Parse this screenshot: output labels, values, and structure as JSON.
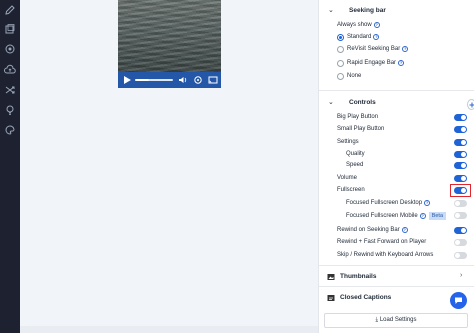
{
  "sidebar": {
    "icons": [
      {
        "name": "edit-icon"
      },
      {
        "name": "layers-icon"
      },
      {
        "name": "settings-cog-icon"
      },
      {
        "name": "cloud-upload-icon"
      },
      {
        "name": "shuffle-icon"
      },
      {
        "name": "bulb-icon"
      },
      {
        "name": "palette-icon"
      }
    ]
  },
  "player": {
    "progress_fraction": 0.35,
    "controls": [
      "play-icon",
      "volume-icon",
      "gear-icon",
      "cast-icon"
    ]
  },
  "seeking_bar": {
    "title": "Seeking bar",
    "always_show_label": "Always show",
    "options": [
      {
        "label": "Standard",
        "selected": true
      },
      {
        "label": "ReVisit Seeking Bar",
        "selected": false
      },
      {
        "label": "Rapid Engage Bar",
        "selected": false
      },
      {
        "label": "None",
        "selected": false
      }
    ]
  },
  "controls": {
    "title": "Controls",
    "items": [
      {
        "label": "Big Play Button",
        "on": true
      },
      {
        "label": "Small Play Button",
        "on": true
      },
      {
        "label": "Settings",
        "on": true
      },
      {
        "label": "Quality",
        "on": true
      },
      {
        "label": "Speed",
        "on": true
      },
      {
        "label": "Volume",
        "on": true
      },
      {
        "label": "Fullscreen",
        "on": true
      },
      {
        "label": "Focused Fullscreen Desktop",
        "on": false
      },
      {
        "label": "Focused Fullscreen Mobile",
        "on": false,
        "badge": "Beta"
      },
      {
        "label": "Rewind on Seeking Bar",
        "on": true
      },
      {
        "label": "Rewind + Fast Forward on Player",
        "on": false
      },
      {
        "label": "Skip / Rewind with Keyboard Arrows",
        "on": false
      }
    ]
  },
  "thumbnails": {
    "title": "Thumbnails"
  },
  "closed_captions": {
    "title": "Closed Captions"
  },
  "load_settings": {
    "label": "Load Settings"
  },
  "colors": {
    "accent": "#1f63d6",
    "highlight": "#e0262f",
    "rail": "#1e2230"
  }
}
